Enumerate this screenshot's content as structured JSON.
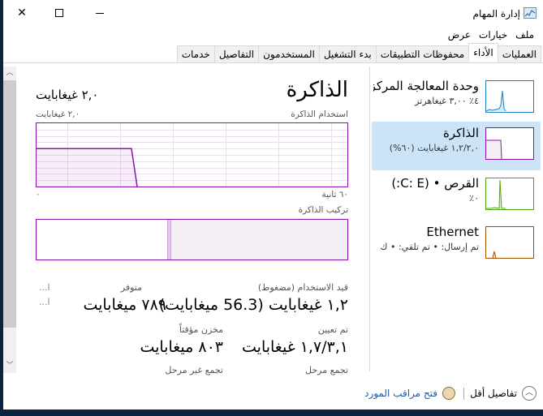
{
  "window": {
    "title": "إدارة المهام",
    "controls": {
      "close": "✕",
      "maximize": "☐",
      "minimize": "—"
    }
  },
  "menu": [
    "ملف",
    "خيارات",
    "عرض"
  ],
  "tabs": [
    {
      "label": "العمليات",
      "active": false
    },
    {
      "label": "الأداء",
      "active": true
    },
    {
      "label": "محفوظات التطبيقات",
      "active": false
    },
    {
      "label": "بدء التشغيل",
      "active": false
    },
    {
      "label": "المستخدمون",
      "active": false
    },
    {
      "label": "التفاصيل",
      "active": false
    },
    {
      "label": "خدمات",
      "active": false
    }
  ],
  "sidebar": [
    {
      "name": "وحدة المعالجة المركزية",
      "sub": "٤٪  ٣,٠٠ غيغاهرتز",
      "color": "#1a7fc0",
      "selected": false
    },
    {
      "name": "الذاكرة",
      "sub": "١,٢/٢,٠ غيغابايت (٦٠%)",
      "color": "#8b12ae",
      "selected": true
    },
    {
      "name": "القرص • (C: E:)",
      "sub": "٠٪",
      "color": "#4da60c",
      "selected": false
    },
    {
      "name": "Ethernet",
      "sub": "تم إرسال: • تم تلقي: • ك",
      "color": "#a74f01",
      "selected": false
    }
  ],
  "main": {
    "title": "الذاكرة",
    "total": "٢,٠ غيغابايت",
    "usage_label": "استخدام الذاكرة",
    "usage_max": "٢,٠ غيغابايت",
    "time_left": "٦٠ ثانية",
    "time_right": "٠",
    "composition_label": "تركيب الذاكرة",
    "usage_history_fraction": 0.6,
    "composition_in_use_fraction": 0.6,
    "stats": {
      "in_use_label": "قيد الاستخدام (مضغوط)",
      "in_use_value": "١,٢ غيغابايت (56.3 ميغابايت)",
      "available_label": "متوفر",
      "available_value": "٧٨٩ ميغابايت",
      "committed_label": "تم تعيين",
      "committed_value": "١,٧/٣,١ غيغابايت",
      "cached_label": "مخزن مؤقتاً",
      "cached_value": "٨٠٣ ميغابايت",
      "paged_label": "تجمع مرحل",
      "nonpaged_label": "تجمع غير مرحل",
      "truncated1": "ا...",
      "truncated2": "ا..."
    }
  },
  "footer": {
    "fewer_details": "تفاصيل أقل",
    "resource_monitor": "فتح مراقب المورد"
  }
}
